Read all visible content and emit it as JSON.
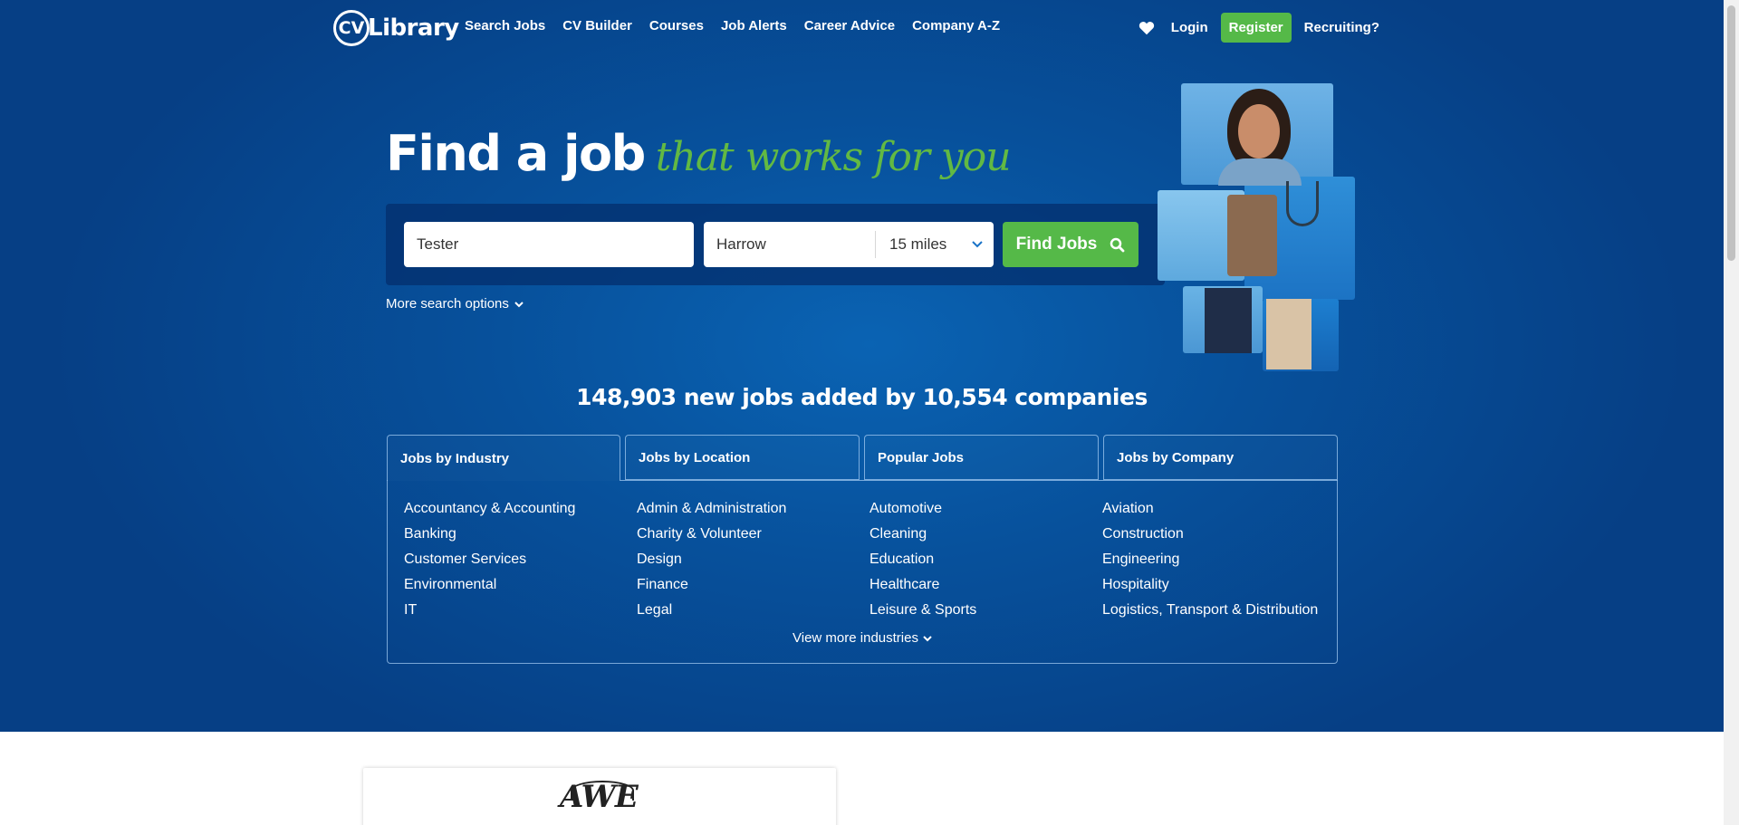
{
  "header": {
    "logo_cv": "CV",
    "logo_text": "Library",
    "nav": [
      "Search Jobs",
      "CV Builder",
      "Courses",
      "Job Alerts",
      "Career Advice",
      "Company A-Z"
    ],
    "login": "Login",
    "register": "Register",
    "recruiting": "Recruiting?"
  },
  "hero": {
    "headline_main": "Find a job",
    "headline_script": "that works for you"
  },
  "search": {
    "keyword_value": "Tester",
    "location_value": "Harrow",
    "radius_value": "15 miles",
    "find_button": "Find Jobs",
    "more_options": "More search options"
  },
  "stats": "148,903 new jobs added by 10,554 companies",
  "tabs": [
    "Jobs by Industry",
    "Jobs by Location",
    "Popular Jobs",
    "Jobs by Company"
  ],
  "industries": [
    "Accountancy & Accounting",
    "Admin & Administration",
    "Automotive",
    "Aviation",
    "Banking",
    "Charity & Volunteer",
    "Cleaning",
    "Construction",
    "Customer Services",
    "Design",
    "Education",
    "Engineering",
    "Environmental",
    "Finance",
    "Healthcare",
    "Hospitality",
    "IT",
    "Legal",
    "Leisure & Sports",
    "Logistics, Transport & Distribution"
  ],
  "view_more": "View more industries",
  "company_logo_text": "AWE",
  "colors": {
    "brand_blue": "#063f85",
    "accent_green": "#55b948",
    "script_green": "#62b943"
  }
}
